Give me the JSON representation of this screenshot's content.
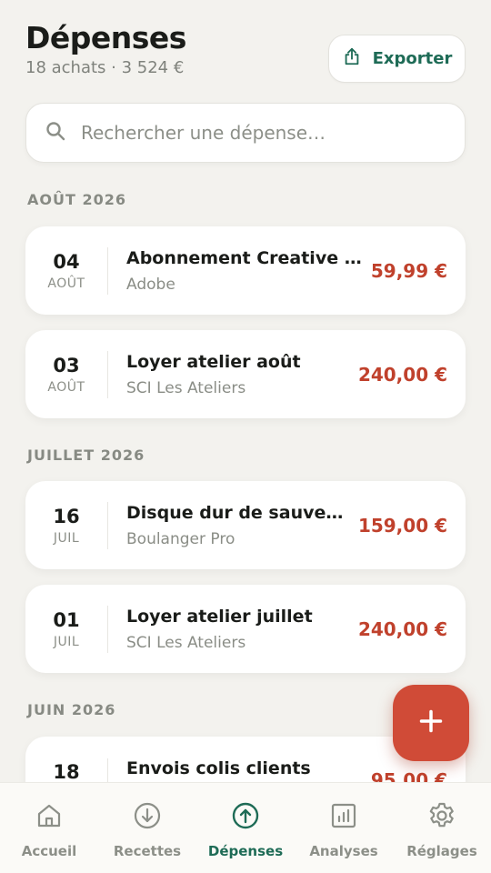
{
  "header": {
    "title": "Dépenses",
    "subtitle": "18 achats · 3 524 €",
    "export_label": "Exporter"
  },
  "search": {
    "placeholder": "Rechercher une dépense…",
    "value": ""
  },
  "sections": [
    {
      "label": "AOÛT 2026",
      "items": [
        {
          "day": "04",
          "month": "AOÛT",
          "name": "Abonnement Creative Cl...",
          "vendor": "Adobe",
          "amount": "59,99 €"
        },
        {
          "day": "03",
          "month": "AOÛT",
          "name": "Loyer atelier août",
          "vendor": "SCI Les Ateliers",
          "amount": "240,00 €"
        }
      ]
    },
    {
      "label": "JUILLET 2026",
      "items": [
        {
          "day": "16",
          "month": "JUIL",
          "name": "Disque dur de sauvegarde",
          "vendor": "Boulanger Pro",
          "amount": "159,00 €"
        },
        {
          "day": "01",
          "month": "JUIL",
          "name": "Loyer atelier juillet",
          "vendor": "SCI Les Ateliers",
          "amount": "240,00 €"
        }
      ]
    },
    {
      "label": "JUIN 2026",
      "items": [
        {
          "day": "18",
          "month": "",
          "name": "Envois colis clients",
          "vendor": "",
          "amount": "95,00 €"
        }
      ]
    }
  ],
  "fab": {
    "icon": "plus-icon"
  },
  "nav": [
    {
      "label": "Accueil",
      "icon": "home-icon",
      "active": false
    },
    {
      "label": "Recettes",
      "icon": "arrow-down-circle-icon",
      "active": false
    },
    {
      "label": "Dépenses",
      "icon": "arrow-up-circle-icon",
      "active": true
    },
    {
      "label": "Analyses",
      "icon": "bar-chart-icon",
      "active": false
    },
    {
      "label": "Réglages",
      "icon": "gear-icon",
      "active": false
    }
  ],
  "colors": {
    "background": "#f3f2ee",
    "accent_green": "#1e6b56",
    "expense_red": "#c0412c",
    "fab_red": "#d04b37",
    "muted_text": "#8c8f88"
  }
}
